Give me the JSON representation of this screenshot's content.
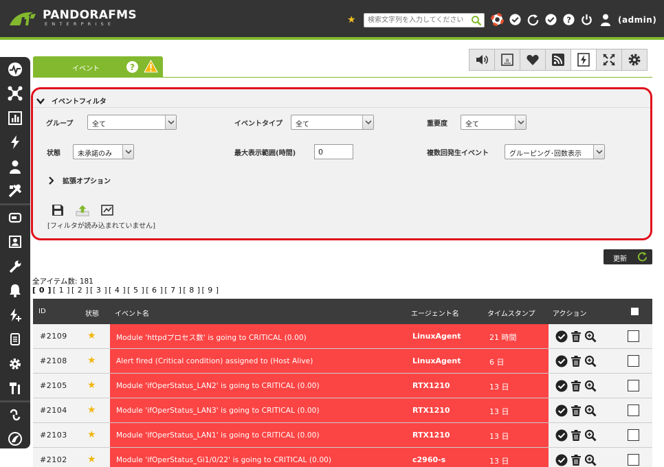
{
  "header": {
    "logo_main": "PANDORAFMS",
    "logo_sub": "ENTERPRISE",
    "search_placeholder": "検索文字列を入力してください",
    "user_label": "(admin)",
    "accent_color": "#82b92e"
  },
  "tab": {
    "label": "イベント"
  },
  "filter": {
    "title": "イベントフィルタ",
    "group_label": "グループ",
    "group_value": "全て",
    "event_type_label": "イベントタイプ",
    "event_type_value": "全て",
    "severity_label": "重要度",
    "severity_value": "全て",
    "status_label": "状態",
    "status_value": "未承諾のみ",
    "max_hours_label": "最大表示範囲(時間)",
    "max_hours_value": "0",
    "repeat_label": "複数回発生イベント",
    "repeat_value": "グルーピング･回数表示",
    "advanced_label": "拡張オプション",
    "note": "[フィルタが読み込まれていません]"
  },
  "update_label": "更新",
  "total_label": "全アイテム数: 181",
  "pages": [
    "0",
    "1",
    "2",
    "3",
    "4",
    "5",
    "6",
    "7",
    "8",
    "9"
  ],
  "table": {
    "columns": {
      "id": "ID",
      "status": "状態",
      "name": "イベント名",
      "agent": "エージェント名",
      "timestamp": "タイムスタンプ",
      "action": "アクション"
    },
    "rows": [
      {
        "id": "#2109",
        "name": "Module 'httpdプロセス数' is going to CRITICAL (0.00)",
        "agent": "LinuxAgent",
        "time": "21 時間"
      },
      {
        "id": "#2108",
        "name": "Alert fired (Critical condition) assigned to (Host Alive)",
        "agent": "LinuxAgent",
        "time": "6 日"
      },
      {
        "id": "#2105",
        "name": "Module 'ifOperStatus_LAN2' is going to CRITICAL (0.00)",
        "agent": "RTX1210",
        "time": "13 日"
      },
      {
        "id": "#2104",
        "name": "Module 'ifOperStatus_LAN3' is going to CRITICAL (0.00)",
        "agent": "RTX1210",
        "time": "13 日"
      },
      {
        "id": "#2103",
        "name": "Module 'ifOperStatus_LAN1' is going to CRITICAL (0.00)",
        "agent": "RTX1210",
        "time": "13 日"
      },
      {
        "id": "#2102",
        "name": "Module 'ifOperStatus_Gi1/0/22' is going to CRITICAL (0.00)",
        "agent": "c2960-s",
        "time": "13 日"
      }
    ]
  },
  "colors": {
    "critical_row": "#fb4444",
    "highlight_border": "#e0111c",
    "sidebar_bg": "#2f2f2f",
    "header_bg": "#343434"
  }
}
